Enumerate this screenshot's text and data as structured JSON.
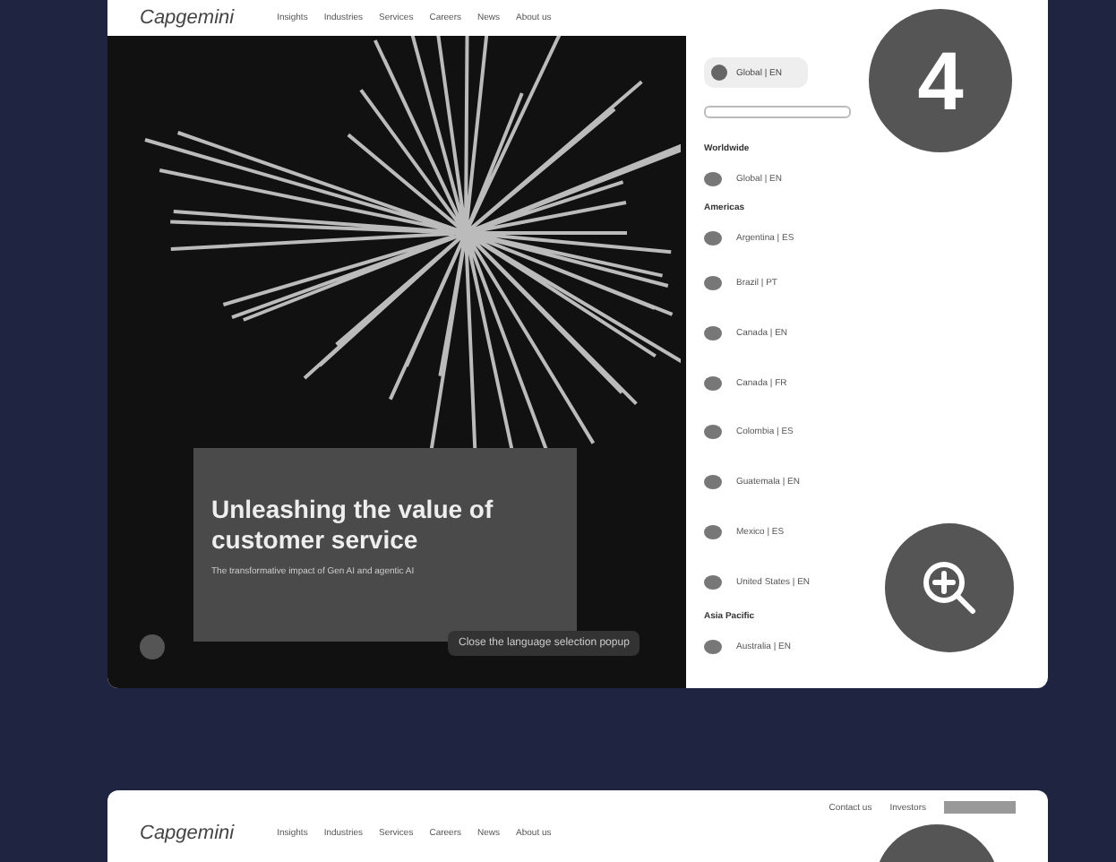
{
  "step_badge": "4",
  "screenshots": [
    {
      "logo": "Capgemini",
      "nav": [
        "Insights",
        "Industries",
        "Services",
        "Careers",
        "News",
        "About us"
      ],
      "hero": {
        "title": "Unleashing the value of customer service",
        "subtitle": "The transformative impact of Gen AI and agentic AI"
      },
      "tooltip": "Close the language selection popup",
      "language_panel": {
        "current": "Global | EN",
        "groups": [
          {
            "heading": "Worldwide",
            "items": [
              "Global | EN"
            ]
          },
          {
            "heading": "Americas",
            "items": [
              "Argentina | ES",
              "Brazil | PT",
              "Canada | EN",
              "Canada | FR",
              "Colombia | ES",
              "Guatemala | EN",
              "Mexico | ES",
              "United States | EN"
            ]
          },
          {
            "heading": "Asia Pacific",
            "items": [
              "Australia | EN"
            ]
          }
        ]
      }
    },
    {
      "logo": "Capgemini",
      "nav": [
        "Insights",
        "Industries",
        "Services",
        "Careers",
        "News",
        "About us"
      ],
      "top_links": [
        "Contact us",
        "Investors"
      ]
    }
  ]
}
